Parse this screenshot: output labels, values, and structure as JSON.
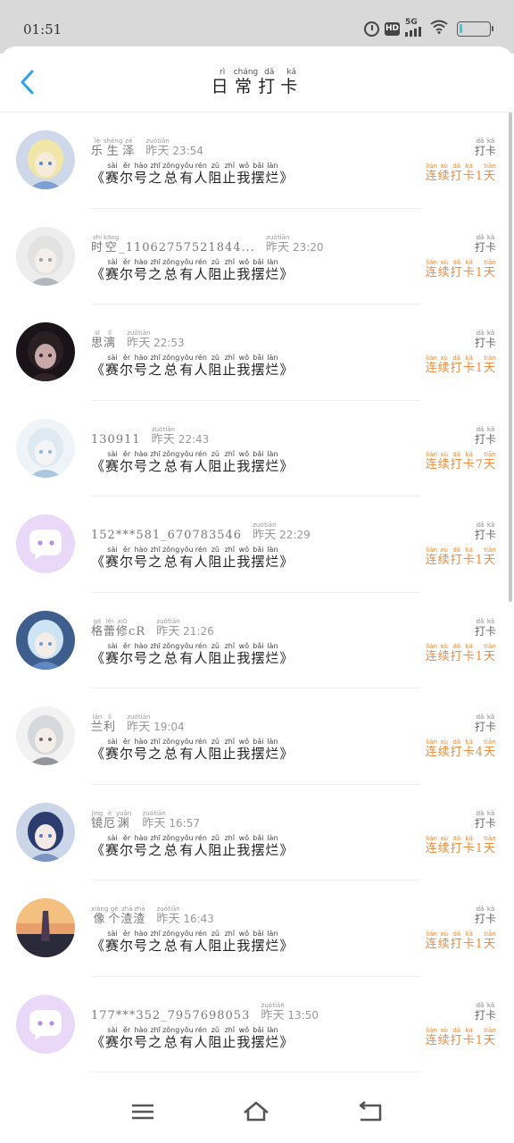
{
  "status_bar": {
    "time": "01:51",
    "network_label": "5G",
    "hd_label": "HD"
  },
  "header": {
    "title_chars": [
      {
        "han": "日",
        "py": "rì"
      },
      {
        "han": "常",
        "py": "cháng"
      },
      {
        "han": "打",
        "py": "dǎ"
      },
      {
        "han": "卡",
        "py": "kǎ"
      }
    ]
  },
  "labels": {
    "punch_chars": [
      {
        "han": "打",
        "py": "dǎ"
      },
      {
        "han": "卡",
        "py": "kǎ"
      }
    ],
    "yesterday_chars": [
      {
        "han": "昨",
        "py": "zuó"
      },
      {
        "han": "天",
        "py": "tiān"
      }
    ],
    "content_chars": [
      {
        "han": "《",
        "py": ""
      },
      {
        "han": "赛",
        "py": "sài"
      },
      {
        "han": "尔",
        "py": "ěr"
      },
      {
        "han": "号",
        "py": "hào"
      },
      {
        "han": "之",
        "py": "zhī"
      },
      {
        "han": "总",
        "py": "zǒng"
      },
      {
        "han": "有",
        "py": "yǒu"
      },
      {
        "han": "人",
        "py": "rén"
      },
      {
        "han": "阻",
        "py": "zǔ"
      },
      {
        "han": "止",
        "py": "zhǐ"
      },
      {
        "han": "我",
        "py": "wǒ"
      },
      {
        "han": "摆",
        "py": "bǎi"
      },
      {
        "han": "烂",
        "py": "làn"
      },
      {
        "han": "》",
        "py": ""
      }
    ],
    "streak_prefix": [
      {
        "han": "连",
        "py": "lián"
      },
      {
        "han": "续",
        "py": "xù"
      },
      {
        "han": "打",
        "py": "dǎ"
      },
      {
        "han": "卡",
        "py": "kǎ"
      }
    ],
    "streak_suffix": {
      "han": "天",
      "py": "tiān"
    }
  },
  "entries": [
    {
      "name_chars": [
        {
          "han": "乐",
          "py": "lè"
        },
        {
          "han": "生",
          "py": "shēng"
        },
        {
          "han": "泽",
          "py": "zé"
        }
      ],
      "time": "23:54",
      "days": "1",
      "avatar": "anime-blond"
    },
    {
      "name_chars": [
        {
          "han": "时",
          "py": "shí"
        },
        {
          "han": "空",
          "py": "kōng"
        },
        {
          "han": "_11062757521844...",
          "py": ""
        }
      ],
      "time": "23:20",
      "days": "1",
      "avatar": "anime-white"
    },
    {
      "name_chars": [
        {
          "han": "思",
          "py": "sī"
        },
        {
          "han": "漓",
          "py": "lí"
        }
      ],
      "time": "22:53",
      "days": "1",
      "avatar": "dark-portrait"
    },
    {
      "name_chars": [
        {
          "han": "130911",
          "py": ""
        }
      ],
      "time": "22:43",
      "days": "7",
      "avatar": "anime-pale"
    },
    {
      "name_chars": [
        {
          "han": "152***581_670783546",
          "py": ""
        }
      ],
      "time": "22:29",
      "days": "1",
      "avatar": "default-chat"
    },
    {
      "name_chars": [
        {
          "han": "格",
          "py": "gé"
        },
        {
          "han": "蕾",
          "py": "lěi"
        },
        {
          "han": "修",
          "py": "xiū"
        },
        {
          "han": "cR",
          "py": ""
        }
      ],
      "time": "21:26",
      "days": "1",
      "avatar": "anime-blue"
    },
    {
      "name_chars": [
        {
          "han": "兰",
          "py": "lán"
        },
        {
          "han": "利",
          "py": "lì"
        }
      ],
      "time": "19:04",
      "days": "4",
      "avatar": "anime-silver"
    },
    {
      "name_chars": [
        {
          "han": "镜",
          "py": "jìng"
        },
        {
          "han": "厄",
          "py": "è"
        },
        {
          "han": "渊",
          "py": "yuān"
        }
      ],
      "time": "16:57",
      "days": "1",
      "avatar": "anime-navy"
    },
    {
      "name_chars": [
        {
          "han": "像",
          "py": "xiàng"
        },
        {
          "han": "个",
          "py": "gè"
        },
        {
          "han": "渣",
          "py": "zhā"
        },
        {
          "han": "渣",
          "py": "zhā"
        }
      ],
      "time": "16:43",
      "days": "1",
      "avatar": "sunset"
    },
    {
      "name_chars": [
        {
          "han": "177***352_7957698053",
          "py": ""
        }
      ],
      "time": "13:50",
      "days": "1",
      "avatar": "default-chat"
    }
  ],
  "colors": {
    "accent_blue": "#2ea3e6",
    "streak_orange": "#f08a3c",
    "default_avatar_bg": "#e9d8f7"
  },
  "navigation": {
    "menu_icon": "menu-icon",
    "home_icon": "home-icon",
    "back_icon": "back-nav-icon"
  }
}
